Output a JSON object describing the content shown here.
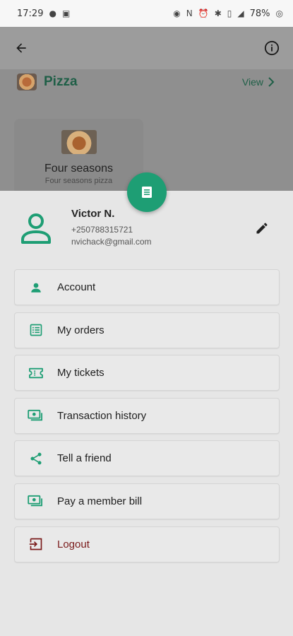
{
  "status_bar": {
    "time": "17:29",
    "battery": "78%"
  },
  "category": {
    "title": "Pizza",
    "view_label": "View"
  },
  "product": {
    "name": "Four seasons",
    "description": "Four seasons pizza"
  },
  "profile": {
    "name": "Victor N.",
    "phone": "+250788315721",
    "email": "nvichack@gmail.com"
  },
  "menu": {
    "items": [
      {
        "label": "Account",
        "icon": "person-icon"
      },
      {
        "label": "My orders",
        "icon": "orders-icon"
      },
      {
        "label": "My tickets",
        "icon": "ticket-icon"
      },
      {
        "label": "Transaction history",
        "icon": "cash-icon"
      },
      {
        "label": "Tell a friend",
        "icon": "share-icon"
      },
      {
        "label": "Pay a member bill",
        "icon": "cash-icon"
      },
      {
        "label": "Logout",
        "icon": "logout-icon"
      }
    ]
  },
  "colors": {
    "accent": "#1e9e74",
    "logout": "#7a1a1a"
  }
}
